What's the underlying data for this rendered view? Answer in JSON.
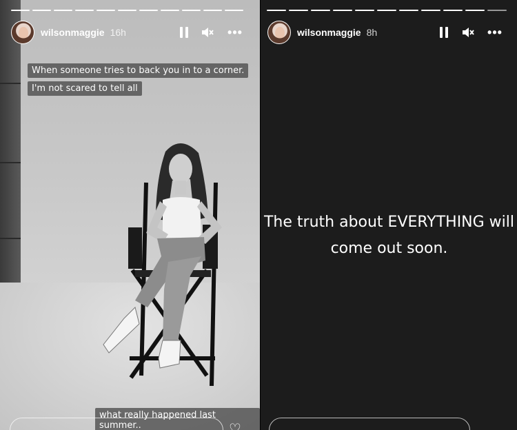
{
  "stories": [
    {
      "username": "wilsonmaggie",
      "time_ago": "16h",
      "captions": [
        "When someone tries to back you in to a corner.",
        "I'm not scared to tell all"
      ],
      "bottom_caption": "what really happened last summer..",
      "progress_segments": 11,
      "progress_done": 11
    },
    {
      "username": "wilsonmaggie",
      "time_ago": "8h",
      "text_lines": [
        "The truth about EVERYTHING will",
        "come out soon."
      ],
      "progress_segments": 11,
      "progress_done": 10
    }
  ],
  "icons": {
    "pause": "pause-icon",
    "mute": "speaker-muted-icon",
    "more": "more-options-icon",
    "like": "heart-icon"
  }
}
